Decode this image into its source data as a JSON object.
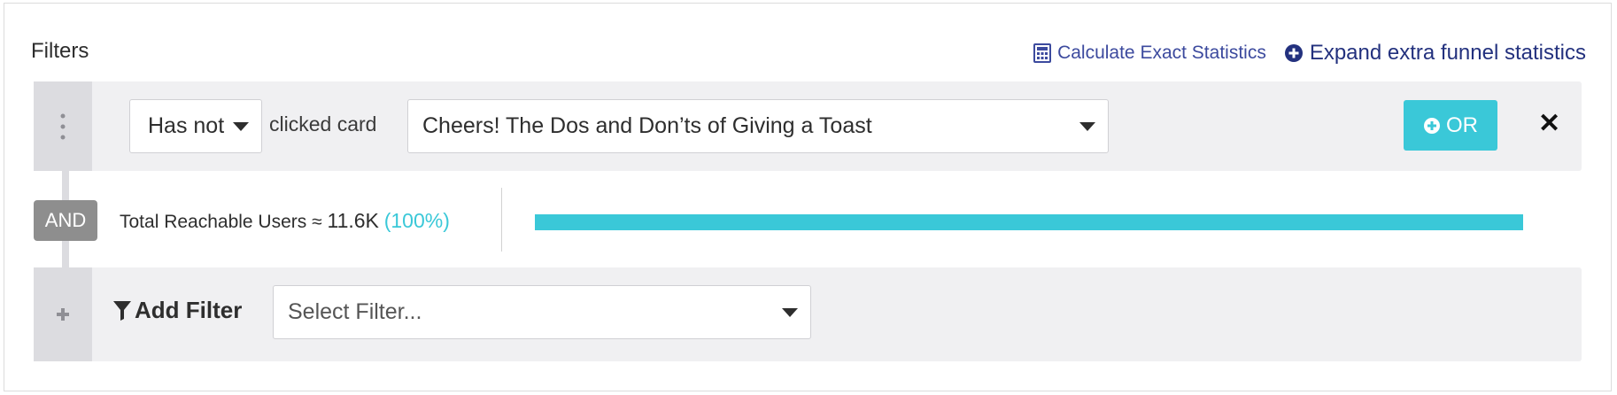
{
  "header": {
    "title": "Filters",
    "calc_link": "Calculate Exact Statistics",
    "expand_link": "Expand extra funnel statistics"
  },
  "filter_row": {
    "operator_value": "Has not",
    "action_text": "clicked card",
    "card_value": "Cheers! The Dos and Don’ts of Giving a Toast",
    "or_label": "OR"
  },
  "combinator": {
    "and_label": "AND",
    "reachable_label": "Total Reachable Users ≈",
    "reachable_count": "11.6K",
    "reachable_percent": "(100%)",
    "progress_fraction": 1.0
  },
  "add_filter": {
    "label": "Add Filter",
    "select_placeholder": "Select Filter..."
  },
  "colors": {
    "accent": "#3ac8d8",
    "link": "#23317e",
    "badge": "#8e8e8e"
  }
}
